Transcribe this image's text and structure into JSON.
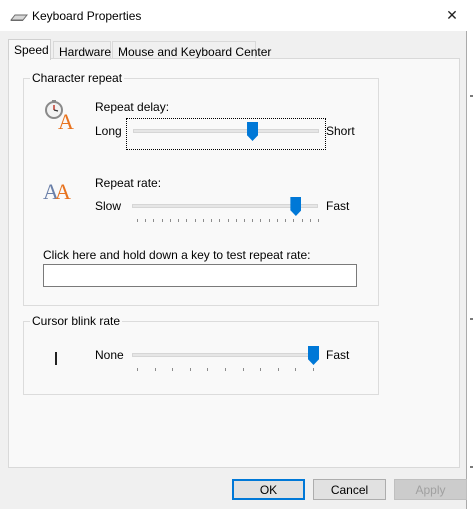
{
  "window": {
    "title": "Keyboard Properties",
    "close_glyph": "✕",
    "icon": "keyboard-icon"
  },
  "tabs": [
    {
      "label": "Speed",
      "active": true
    },
    {
      "label": "Hardware",
      "active": false
    },
    {
      "label": "Mouse and Keyboard Center",
      "active": false
    }
  ],
  "character_repeat": {
    "group_label": "Character repeat",
    "repeat_delay": {
      "label": "Repeat delay:",
      "mnemonic": "d",
      "min_label": "Long",
      "max_label": "Short",
      "value_fraction": 0.63,
      "icon": "repeat-delay-icon"
    },
    "repeat_rate": {
      "label": "Repeat rate:",
      "mnemonic": "R",
      "min_label": "Slow",
      "max_label": "Fast",
      "value_fraction": 0.875,
      "icon": "repeat-rate-icon"
    },
    "test_prompt": "Click here and hold down a key to test repeat rate:",
    "test_value": ""
  },
  "cursor_blink": {
    "group_label": "Cursor blink rate",
    "mnemonic": "b",
    "min_label": "None",
    "max_label": "Fast",
    "value_fraction": 1.0,
    "icon": "cursor-icon"
  },
  "buttons": {
    "ok": "OK",
    "cancel": "Cancel",
    "apply": "Apply"
  },
  "colors": {
    "accent": "#0078d7",
    "icon_orange": "#e8731f",
    "icon_gray": "#8a8a8a"
  }
}
